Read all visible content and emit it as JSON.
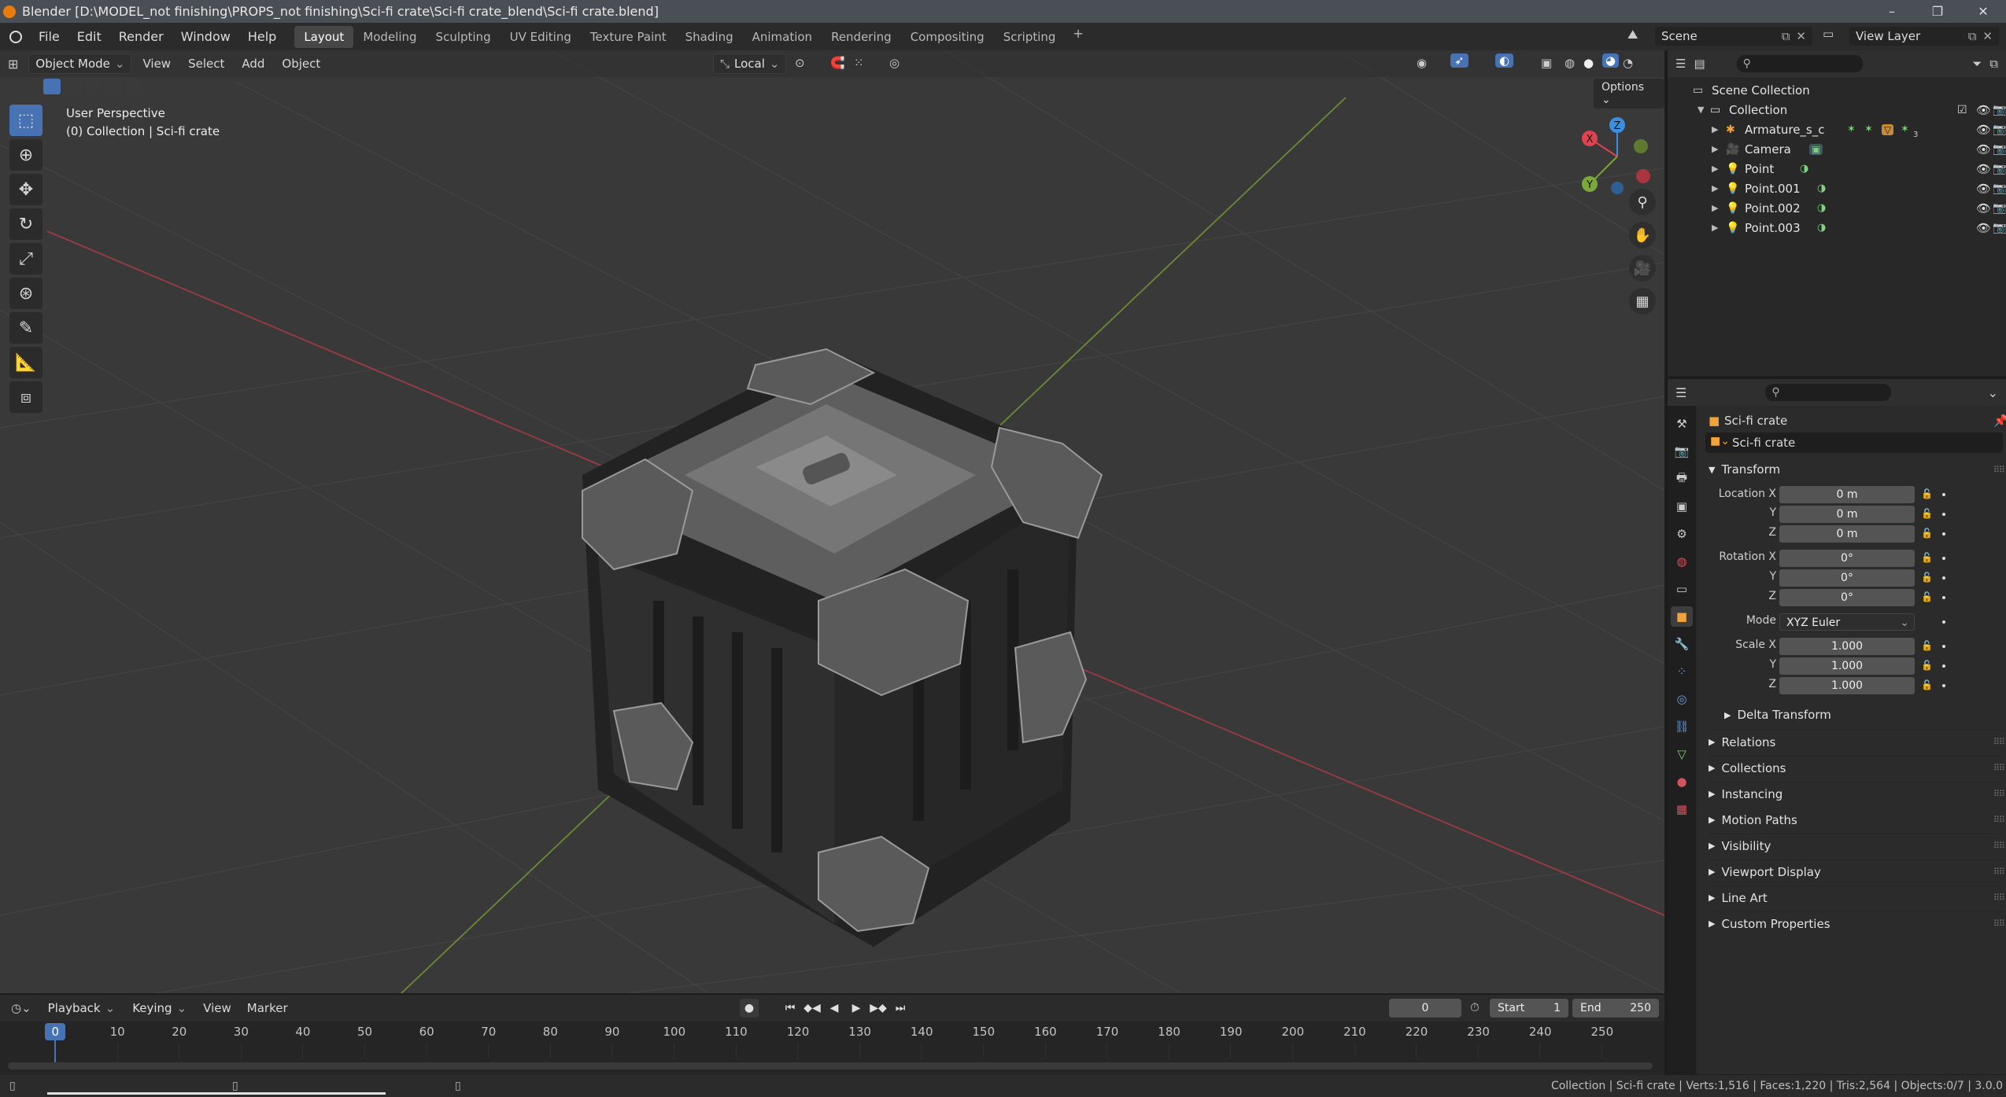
{
  "window": {
    "title": "Blender [D:\\MODEL_not finishing\\PROPS_not finishing\\Sci-fi crate\\Sci-fi crate_blend\\Sci-fi crate.blend]",
    "controls": [
      "–",
      "❐",
      "✕"
    ]
  },
  "menu": [
    "File",
    "Edit",
    "Render",
    "Window",
    "Help"
  ],
  "workspaces": [
    "Layout",
    "Modeling",
    "Sculpting",
    "UV Editing",
    "Texture Paint",
    "Shading",
    "Animation",
    "Rendering",
    "Compositing",
    "Scripting"
  ],
  "active_workspace": "Layout",
  "scene": {
    "scene_label": "Scene",
    "view_layer_label": "View Layer"
  },
  "viewport_header": {
    "mode": "Object Mode",
    "menus": [
      "View",
      "Select",
      "Add",
      "Object"
    ],
    "orientation": "Local",
    "options_label": "Options"
  },
  "viewport_overlay": {
    "line1": "User Perspective",
    "line2": "(0) Collection | Sci-fi crate"
  },
  "gizmo_axes": [
    "Z",
    "Y",
    "X"
  ],
  "outliner": {
    "root": "Scene Collection",
    "collection": "Collection",
    "items": [
      {
        "name": "Armature_s_c",
        "icon": "armature-icon",
        "extra": "3"
      },
      {
        "name": "Camera",
        "icon": "camera-icon"
      },
      {
        "name": "Point",
        "icon": "light-icon"
      },
      {
        "name": "Point.001",
        "icon": "light-icon"
      },
      {
        "name": "Point.002",
        "icon": "light-icon"
      },
      {
        "name": "Point.003",
        "icon": "light-icon"
      }
    ]
  },
  "properties": {
    "object_name": "Sci-fi crate",
    "data_name": "Sci-fi crate",
    "transform_title": "Transform",
    "location_label": "Location X",
    "rotation_label": "Rotation X",
    "scale_label": "Scale X",
    "y_label": "Y",
    "z_label": "Z",
    "location": [
      "0 m",
      "0 m",
      "0 m"
    ],
    "rotation": [
      "0°",
      "0°",
      "0°"
    ],
    "mode_label": "Mode",
    "mode_value": "XYZ Euler",
    "scale": [
      "1.000",
      "1.000",
      "1.000"
    ],
    "delta_transform": "Delta Transform",
    "sections": [
      "Relations",
      "Collections",
      "Instancing",
      "Motion Paths",
      "Visibility",
      "Viewport Display",
      "Line Art",
      "Custom Properties"
    ]
  },
  "timeline": {
    "menus": [
      "Playback",
      "Keying",
      "View",
      "Marker"
    ],
    "current_frame": "0",
    "start_label": "Start",
    "start": "1",
    "end_label": "End",
    "end": "250",
    "ticks": [
      "0",
      "10",
      "20",
      "30",
      "40",
      "50",
      "60",
      "70",
      "80",
      "90",
      "100",
      "110",
      "120",
      "130",
      "140",
      "150",
      "160",
      "170",
      "180",
      "190",
      "200",
      "210",
      "220",
      "230",
      "240",
      "250"
    ]
  },
  "status": {
    "text": "Collection | Sci-fi crate | Verts:1,516 | Faces:1,220 | Tris:2,564 | Objects:0/7 | 3.0.0"
  },
  "colors": {
    "accent": "#4772b3",
    "x_axis": "#e0424f",
    "y_axis": "#7ba73b",
    "z_axis": "#3b8fe0",
    "object_orange": "#f2a23a"
  }
}
